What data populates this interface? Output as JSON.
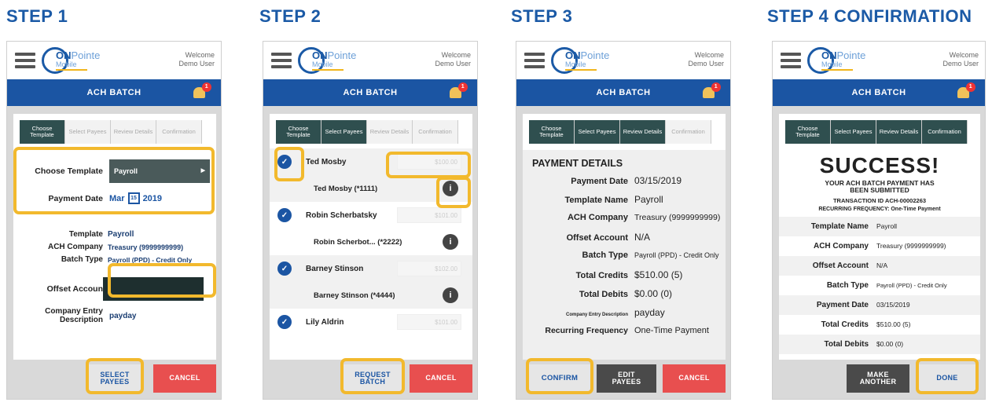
{
  "app": {
    "logo_main": "ON",
    "logo_pointe": "Pointe",
    "logo_sub": "Mobile",
    "welcome_line1": "Welcome",
    "welcome_line2": "Demo User",
    "bar_title": "ACH BATCH",
    "badge_count": "1"
  },
  "colors": {
    "brand_blue": "#1b55a3",
    "highlight": "#f2b92d",
    "cancel_red": "#e84f4f",
    "tab_done": "#2f4f4f"
  },
  "tabs": [
    "Choose Template",
    "Select Payees",
    "Review Details",
    "Confirmation"
  ],
  "step1": {
    "title": "STEP 1",
    "choose_template_label": "Choose Template",
    "choose_template_value": "Payroll",
    "payment_date_label": "Payment Date",
    "payment_date_month": "Mar",
    "payment_date_day": "15",
    "payment_date_year": "2019",
    "template_label": "Template",
    "template_value": "Payroll",
    "ach_company_label": "ACH Company",
    "ach_company_value": "Treasury (9999999999)",
    "batch_type_label": "Batch Type",
    "batch_type_value": "Payroll (PPD) - Credit Only",
    "offset_label": "Offset Accoun",
    "company_entry_label1": "Company Entry",
    "company_entry_label2": "Description",
    "company_entry_value": "payday",
    "select_payees_line1": "SELECT",
    "select_payees_line2": "PAYEES",
    "cancel": "CANCEL"
  },
  "step2": {
    "title": "STEP 2",
    "payees": [
      {
        "name": "Ted Mosby",
        "amount": "$100.00",
        "sub": "Ted Mosby (*1111)"
      },
      {
        "name": "Robin Scherbatsky",
        "amount": "$101.00",
        "sub": "Robin Scherbot...  (*2222)"
      },
      {
        "name": "Barney Stinson",
        "amount": "$102.00",
        "sub": "Barney Stinson (*4444)"
      },
      {
        "name": "Lily Aldrin",
        "amount": "$101.00"
      }
    ],
    "request_line1": "REQUEST",
    "request_line2": "BATCH",
    "cancel": "CANCEL"
  },
  "step3": {
    "title": "STEP 3",
    "heading": "PAYMENT DETAILS",
    "rows": [
      {
        "label": "Payment Date",
        "value": "03/15/2019"
      },
      {
        "label": "Template Name",
        "value": "Payroll"
      },
      {
        "label": "ACH Company",
        "value": "Treasury (9999999999)"
      },
      {
        "label": "Offset Account",
        "value": "N/A"
      },
      {
        "label": "Batch Type",
        "value": "Payroll (PPD) - Credit Only"
      },
      {
        "label": "Total Credits",
        "value": "$510.00 (5)"
      },
      {
        "label": "Total Debits",
        "value": "$0.00 (0)"
      },
      {
        "label": "Company Entry Description",
        "value": "payday"
      },
      {
        "label": "Recurring Frequency",
        "value": "One-Time Payment"
      }
    ],
    "confirm": "CONFIRM",
    "edit_line1": "EDIT",
    "edit_line2": "PAYEES",
    "cancel": "CANCEL"
  },
  "step4": {
    "title": "STEP 4 CONFIRMATION",
    "success": "SUCCESS!",
    "submitted_line1": "YOUR ACH BATCH PAYMENT HAS",
    "submitted_line2": "BEEN SUBMITTED",
    "transaction": "TRANSACTION ID ACH-00002263",
    "recurring": "RECURRING FREQUENCY: One-Time Payment",
    "rows": [
      {
        "label": "Template Name",
        "value": "Payroll"
      },
      {
        "label": "ACH Company",
        "value": "Treasury (9999999999)"
      },
      {
        "label": "Offset Account",
        "value": "N/A"
      },
      {
        "label": "Batch Type",
        "value": "Payroll (PPD) - Credit Only"
      },
      {
        "label": "Payment Date",
        "value": "03/15/2019"
      },
      {
        "label": "Total Credits",
        "value": "$510.00 (5)"
      },
      {
        "label": "Total Debits",
        "value": "$0.00 (0)"
      }
    ],
    "make_line1": "MAKE",
    "make_line2": "ANOTHER",
    "done": "DONE"
  }
}
